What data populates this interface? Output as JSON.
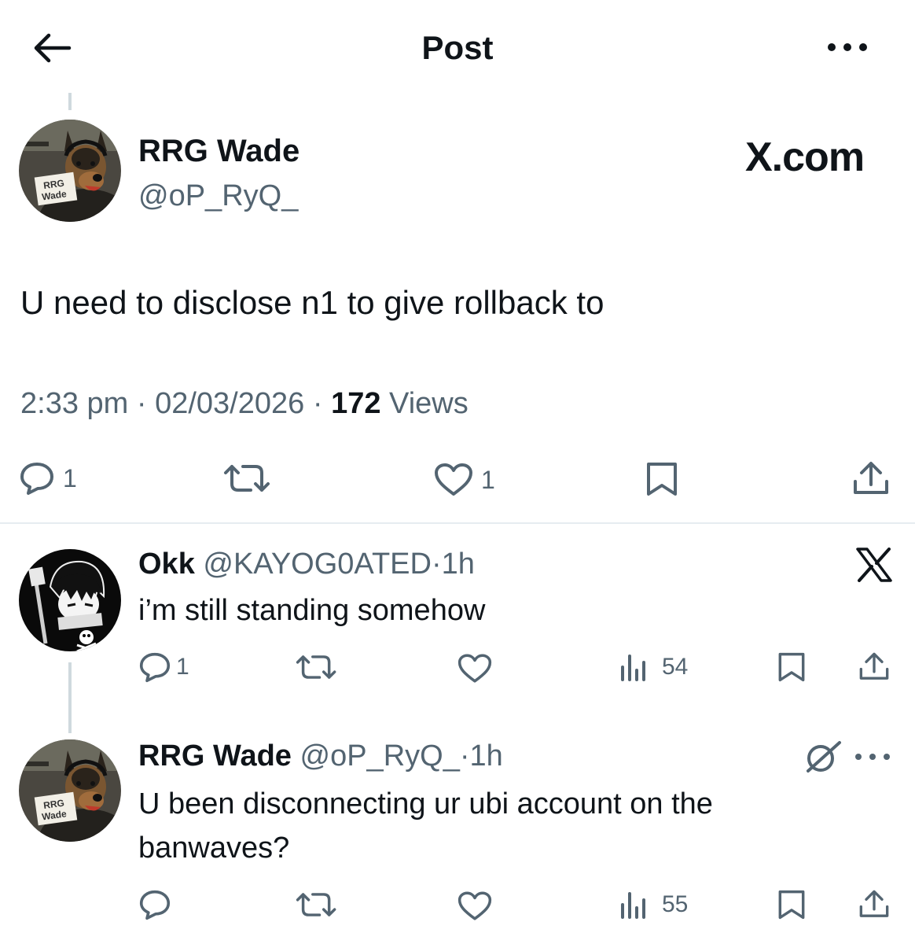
{
  "header": {
    "title": "Post",
    "back_icon": "arrow-left-icon",
    "more_icon": "more-dots-icon"
  },
  "main_post": {
    "name": "RRG Wade",
    "handle": "@oP_RyQ_",
    "badge": "X.com",
    "avatar_sign": "RRG\nWade",
    "text": "U need to disclose n1 to give rollback to",
    "time": "2:33 pm",
    "date": "02/03/2026",
    "sep": "·",
    "views_count": "172",
    "views_label": "Views",
    "actions": {
      "replies": "1",
      "reposts": "",
      "likes": "1"
    }
  },
  "replies": [
    {
      "name": "Okk",
      "handle": "@KAYOG0ATED",
      "time": "1h",
      "sep": "·",
      "text": "i’m still standing somehow",
      "actions": {
        "replies": "1",
        "views": "54"
      }
    },
    {
      "name": "RRG Wade",
      "handle": "@oP_RyQ_",
      "time": "1h",
      "sep": "·",
      "text": "U been disconnecting ur ubi account on the banwaves?",
      "avatar_sign": "RRG\nWade",
      "actions": {
        "replies": "",
        "views": "55"
      }
    }
  ],
  "colors": {
    "text": "#0f1419",
    "secondary": "#536471",
    "divider": "#e6ecf0",
    "thread": "#cfd9de"
  }
}
